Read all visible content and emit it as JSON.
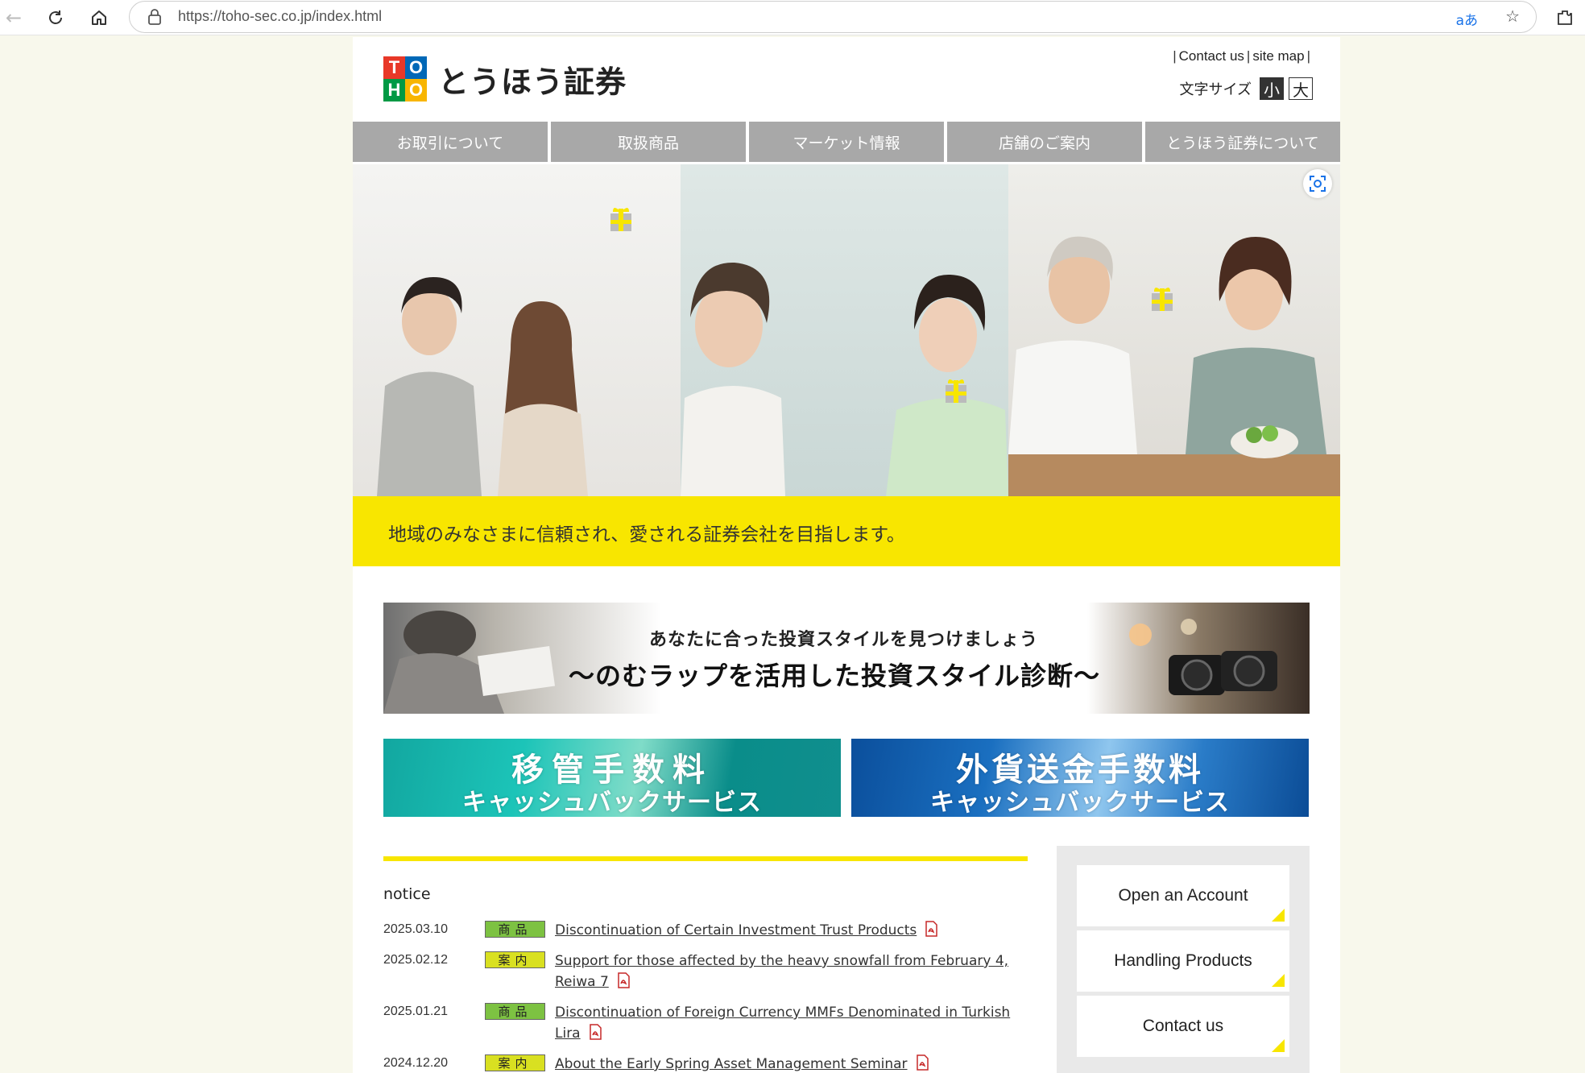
{
  "browser": {
    "url": "https://toho-sec.co.jp/index.html",
    "translate_label": "aあ"
  },
  "header": {
    "logo_text": "とうほう証券",
    "logo_mark": [
      "T",
      "O",
      "H",
      "O"
    ],
    "links": [
      "Contact us",
      "site map"
    ],
    "font_size_label": "文字サイズ",
    "font_small": "小",
    "font_large": "大"
  },
  "nav": {
    "items": [
      "お取引について",
      "取扱商品",
      "マーケット情報",
      "店舗のご案内",
      "とうほう証券について"
    ]
  },
  "hero": {
    "tagline": "地域のみなさまに信頼され、愛される証券会社を目指します。"
  },
  "banners": {
    "main_line1": "あなたに合った投資スタイルを見つけましょう",
    "main_line2": "～のむラップを活用した投資スタイル診断～",
    "transfer_line1": "移管手数料",
    "transfer_line2": "キャッシュバックサービス",
    "fx_line1": "外貨送金手数料",
    "fx_line2": "キャッシュバックサービス"
  },
  "notice": {
    "title": "notice",
    "items": [
      {
        "date": "2025.03.10",
        "tag": "商品",
        "tag_color": "#7dc242",
        "text": "Discontinuation of Certain Investment Trust Products"
      },
      {
        "date": "2025.02.12",
        "tag": "案内",
        "tag_color": "#d9e021",
        "text": "Support for those affected by the heavy snowfall from February 4, Reiwa 7"
      },
      {
        "date": "2025.01.21",
        "tag": "商品",
        "tag_color": "#7dc242",
        "text": "Discontinuation of Foreign Currency MMFs Denominated in Turkish Lira"
      },
      {
        "date": "2024.12.20",
        "tag": "案内",
        "tag_color": "#d9e021",
        "text": "About the Early Spring Asset Management Seminar"
      }
    ]
  },
  "sidebar": {
    "buttons": [
      "Open an Account",
      "Handling Products",
      "Contact us"
    ]
  },
  "colors": {
    "brand_yellow": "#f8e600",
    "nav_gray": "#a8a8a8"
  }
}
